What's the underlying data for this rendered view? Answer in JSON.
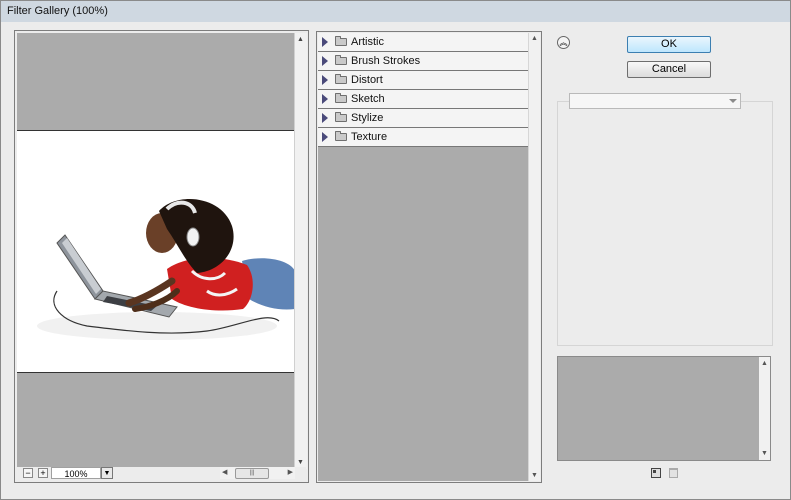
{
  "window": {
    "title": "Filter Gallery (100%)"
  },
  "preview": {
    "zoom_value": "100%",
    "zoom_in_label": "+",
    "zoom_out_label": "−",
    "image_description_icon": "photo-girl-laptop"
  },
  "filters": {
    "categories": [
      {
        "label": "Artistic"
      },
      {
        "label": "Brush Strokes"
      },
      {
        "label": "Distort"
      },
      {
        "label": "Sketch"
      },
      {
        "label": "Stylize"
      },
      {
        "label": "Texture"
      }
    ]
  },
  "buttons": {
    "ok": "OK",
    "cancel": "Cancel"
  },
  "settings": {
    "selected_filter": ""
  },
  "colors": {
    "canvas_gray": "#ababab",
    "ok_button": "#bee6fd"
  }
}
